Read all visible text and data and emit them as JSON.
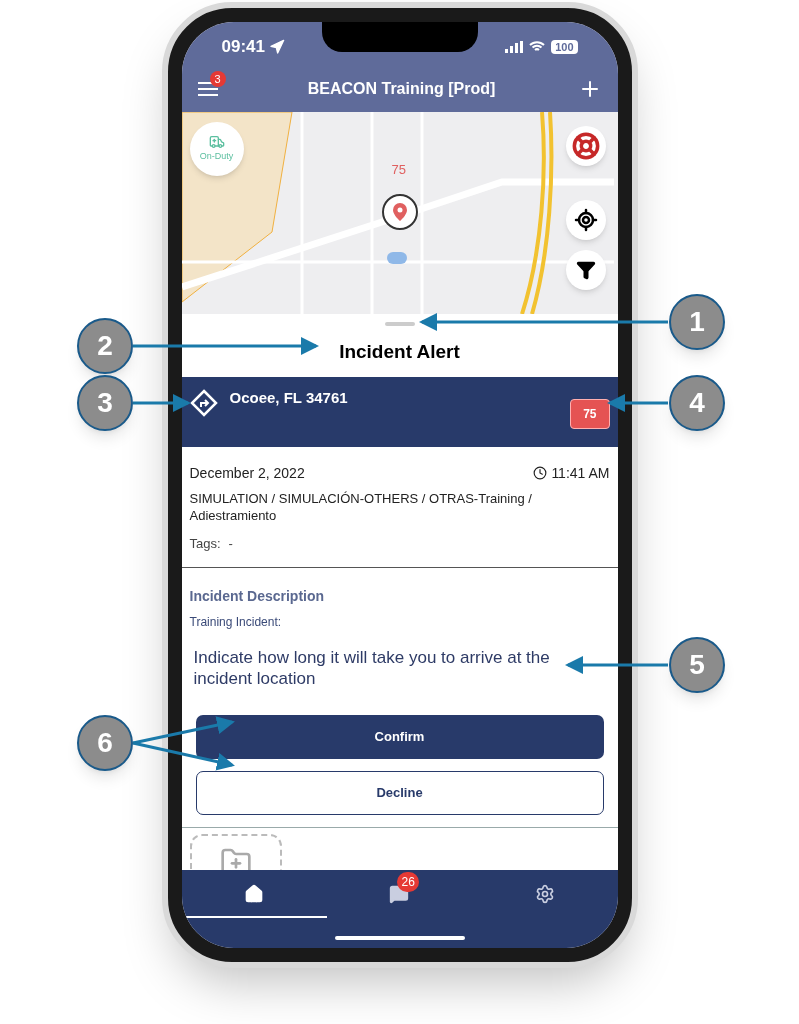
{
  "status_bar": {
    "time": "09:41",
    "battery": "100"
  },
  "app_bar": {
    "title": "BEACON Training [Prod]",
    "menu_badge": "3"
  },
  "map": {
    "duty_status": "On-Duty",
    "marker_label": "75"
  },
  "sheet": {
    "title": "Incident Alert"
  },
  "incident": {
    "address": "Ocoee, FL 34761",
    "priority": "75",
    "date": "December 2, 2022",
    "time": "11:41 AM",
    "type": "SIMULATION / SIMULACIÓN-OTHERS / OTRAS-Training / Adiestramiento",
    "tags_label": "Tags:",
    "tags_value": "-"
  },
  "description": {
    "heading": "Incident Description",
    "label": "Training Incident:",
    "prompt": "Indicate how long it will take you to arrive at the incident location",
    "buttons": [
      {
        "label": "Confirm",
        "kind": "primary"
      },
      {
        "label": "Decline",
        "kind": "secondary"
      }
    ]
  },
  "tab_bar": [
    {
      "kind": "home",
      "selected": true
    },
    {
      "kind": "messages",
      "badge": "26",
      "selected": false
    },
    {
      "kind": "settings",
      "selected": false
    }
  ],
  "callouts": [
    "1",
    "2",
    "3",
    "4",
    "5",
    "6"
  ]
}
